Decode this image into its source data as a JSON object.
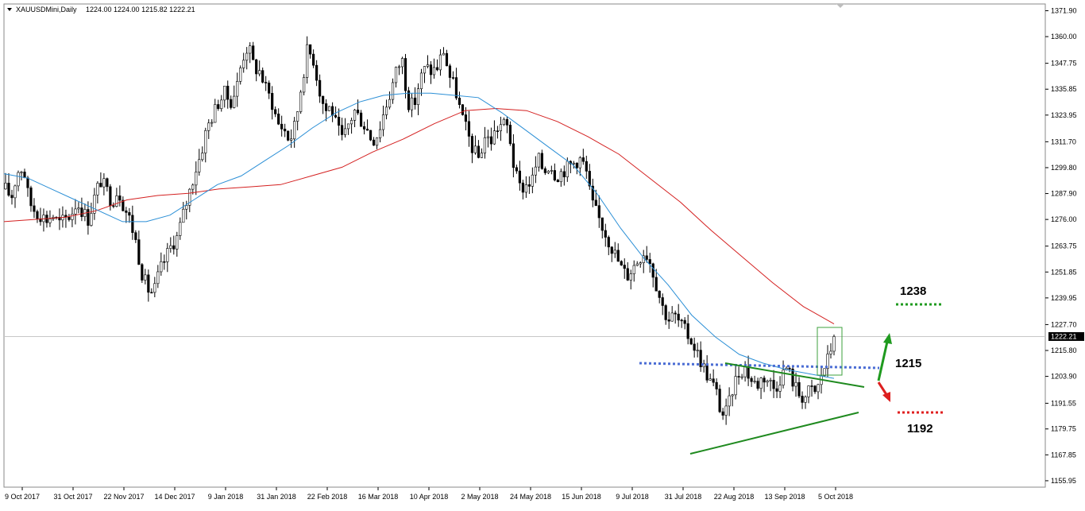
{
  "chart_data": {
    "type": "candlestick",
    "header": {
      "symbol_label": "XAUUSDMini,Daily",
      "ohlc_values": "1224.00 1224.00 1215.82 1222.21"
    },
    "price_range": [
      1153.0,
      1375.0
    ],
    "y_ticks": [
      "1371.90",
      "1360.00",
      "1347.75",
      "1335.85",
      "1323.95",
      "1311.70",
      "1299.80",
      "1287.90",
      "1276.00",
      "1263.75",
      "1251.85",
      "1239.95",
      "1227.70",
      "1215.80",
      "1203.90",
      "1191.55",
      "1179.75",
      "1167.85",
      "1155.95"
    ],
    "x_labels": [
      "9 Oct 2017",
      "31 Oct 2017",
      "22 Nov 2017",
      "14 Dec 2017",
      "9 Jan 2018",
      "31 Jan 2018",
      "22 Feb 2018",
      "16 Mar 2018",
      "10 Apr 2018",
      "2 May 2018",
      "24 May 2018",
      "15 Jun 2018",
      "9 Jul 2018",
      "31 Jul 2018",
      "22 Aug 2018",
      "13 Sep 2018",
      "5 Oct 2018"
    ],
    "current_price": 1222.21,
    "current_price_label": "1222.21",
    "price_track": [
      1290,
      1286,
      1298,
      1300,
      1284,
      1280,
      1278,
      1276,
      1278,
      1274,
      1276,
      1278,
      1284,
      1280,
      1276,
      1286,
      1294,
      1290,
      1284,
      1290,
      1282,
      1276,
      1266,
      1252,
      1244,
      1242,
      1252,
      1258,
      1264,
      1268,
      1278,
      1288,
      1298,
      1306,
      1318,
      1324,
      1330,
      1334,
      1330,
      1336,
      1350,
      1356,
      1346,
      1344,
      1336,
      1330,
      1320,
      1318,
      1312,
      1320,
      1338,
      1354,
      1350,
      1336,
      1326,
      1328,
      1318,
      1312,
      1320,
      1326,
      1322,
      1318,
      1312,
      1316,
      1326,
      1334,
      1344,
      1350,
      1330,
      1328,
      1340,
      1346,
      1344,
      1346,
      1354,
      1342,
      1336,
      1324,
      1316,
      1308,
      1304,
      1314,
      1312,
      1318,
      1320,
      1318,
      1298,
      1290,
      1292,
      1294,
      1304,
      1298,
      1302,
      1296,
      1298,
      1300,
      1302,
      1304,
      1300,
      1284,
      1278,
      1272,
      1266,
      1260,
      1254,
      1250,
      1254,
      1258,
      1262,
      1256,
      1246,
      1236,
      1230,
      1232,
      1228,
      1224,
      1220,
      1214,
      1208,
      1202,
      1198,
      1186,
      1188,
      1200,
      1206,
      1208,
      1202,
      1200,
      1204,
      1202,
      1198,
      1204,
      1208,
      1202,
      1196,
      1194,
      1198,
      1196,
      1206,
      1212,
      1222
    ],
    "overlays": {
      "ma_fast": {
        "color": "#2b8fd6",
        "values": [
          1297,
          1295,
          1290,
          1285,
          1280,
          1275,
          1275,
          1278,
          1285,
          1292,
          1296,
          1303,
          1310,
          1318,
          1325,
          1330,
          1333,
          1334,
          1334,
          1333,
          1332,
          1325,
          1317,
          1309,
          1301,
          1288,
          1272,
          1258,
          1246,
          1232,
          1222,
          1214,
          1210,
          1207,
          1205,
          1203
        ]
      },
      "ma_slow": {
        "color": "#d42020",
        "values": [
          1275,
          1276,
          1277,
          1280,
          1285,
          1287,
          1288,
          1290,
          1291,
          1292,
          1296,
          1300,
          1307,
          1313,
          1320,
          1326,
          1327,
          1326,
          1321,
          1314,
          1306,
          1295,
          1284,
          1271,
          1259,
          1247,
          1236,
          1228
        ]
      }
    },
    "annotations": {
      "level_up": "1238",
      "level_mid": "1215",
      "level_down": "1192"
    }
  }
}
